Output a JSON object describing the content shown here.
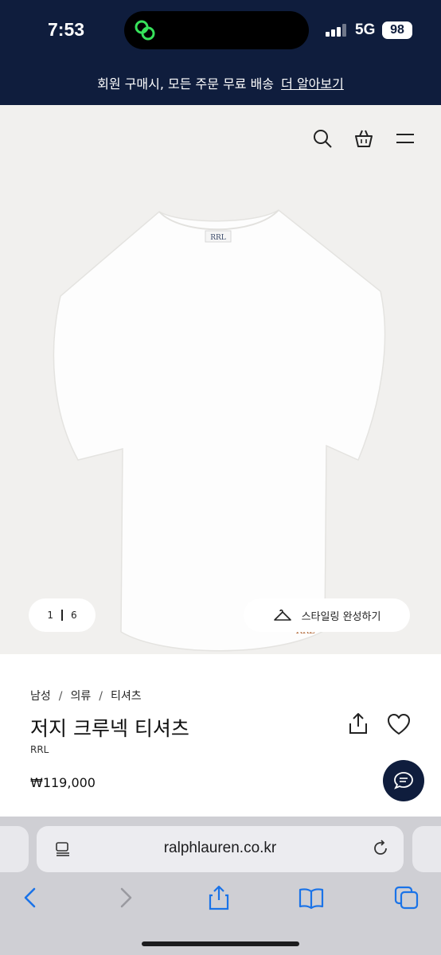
{
  "status_bar": {
    "time": "7:53",
    "network": "5G",
    "battery": "98"
  },
  "promo": {
    "text": "회원 구매시, 모든 주문 무료 배송",
    "link": "더 알아보기"
  },
  "gallery": {
    "current": "1",
    "total": "6",
    "style_button": "스타일링 완성하기",
    "label_collar": "RRL",
    "label_hem": "RRL"
  },
  "breadcrumb": [
    "남성",
    "의류",
    "티셔츠"
  ],
  "product": {
    "title": "저지 크루넥 티셔츠",
    "brand": "RRL",
    "price": "₩119,000"
  },
  "browser": {
    "url": "ralphlauren.co.kr"
  },
  "colors": {
    "navy": "#0f1d3d",
    "image_bg": "#f1f0ee"
  },
  "icons": [
    "search-icon",
    "bag-icon",
    "menu-icon",
    "hanger-icon",
    "share-icon",
    "heart-icon",
    "chat-icon",
    "tabs-icon",
    "reload-icon",
    "back-icon",
    "forward-icon",
    "share-icon",
    "bookmarks-icon",
    "tabs-overview-icon"
  ]
}
